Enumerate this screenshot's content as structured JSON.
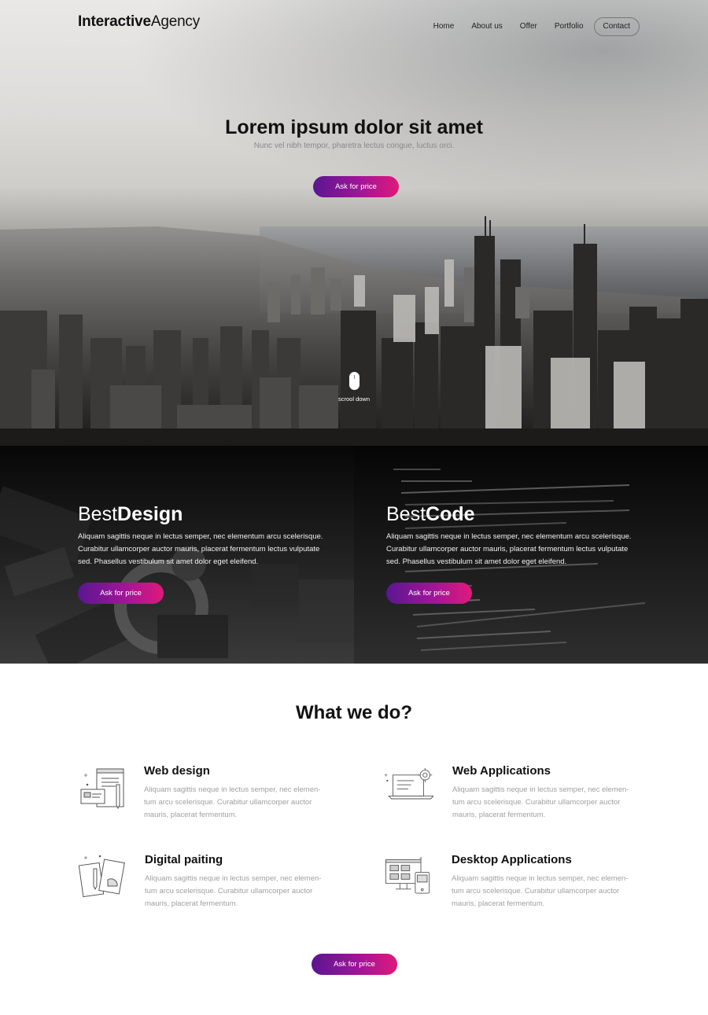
{
  "header": {
    "logo_bold": "Interactive",
    "logo_light": "Agency",
    "nav": [
      {
        "label": "Home"
      },
      {
        "label": "About us"
      },
      {
        "label": "Offer"
      },
      {
        "label": "Portfolio"
      },
      {
        "label": "Contact"
      }
    ]
  },
  "hero": {
    "title": "Lorem ipsum dolor sit amet",
    "subtitle": "Nunc vel nibh tempor, pharetra lectus congue, luctus orci.",
    "cta_label": "Ask for price",
    "scroll_label": "scrool down"
  },
  "features": [
    {
      "title_light": "Best",
      "title_bold": "Design",
      "text": "Aliquam sagittis neque in lectus semper, nec elementum arcu scelerisque. Curabitur ullamcorper auctor mauris, placerat fermentum lectus vulputate sed. Phasellus vestibulum sit amet dolor eget eleifend.",
      "cta_label": "Ask for price"
    },
    {
      "title_light": "Best",
      "title_bold": "Code",
      "text": "Aliquam sagittis neque in lectus semper, nec elementum arcu scelerisque. Curabitur ullamcorper auctor mauris, placerat fermentum lectus vulputate sed. Phasellus vestibulum sit amet dolor eget eleifend.",
      "cta_label": "Ask for price"
    }
  ],
  "services": {
    "title": "What we do?",
    "items": [
      {
        "title": "Web design",
        "text": "Aliquam sagittis neque in lectus semper, nec elemen-tum arcu scelerisque. Curabitur ullamcorper auctor mauris, placerat fermentum.",
        "icon": "web-design-icon"
      },
      {
        "title": "Web Applications",
        "text": "Aliquam sagittis neque in lectus semper, nec elemen-tum arcu scelerisque. Curabitur ullamcorper auctor mauris, placerat fermentum.",
        "icon": "web-applications-icon"
      },
      {
        "title": "Digital paiting",
        "text": "Aliquam sagittis neque in lectus semper, nec elemen-tum arcu scelerisque. Curabitur ullamcorper auctor mauris, placerat fermentum.",
        "icon": "digital-painting-icon"
      },
      {
        "title": "Desktop Applications",
        "text": "Aliquam sagittis neque in lectus semper, nec elemen-tum arcu scelerisque. Curabitur ullamcorper auctor mauris, placerat fermentum.",
        "icon": "desktop-applications-icon"
      }
    ],
    "cta_label": "Ask for price"
  },
  "colors": {
    "gradient_start": "#5a1691",
    "gradient_mid": "#a11598",
    "gradient_end": "#e0197a",
    "dark_band": "#050505",
    "muted_text": "#a0a0a0"
  }
}
